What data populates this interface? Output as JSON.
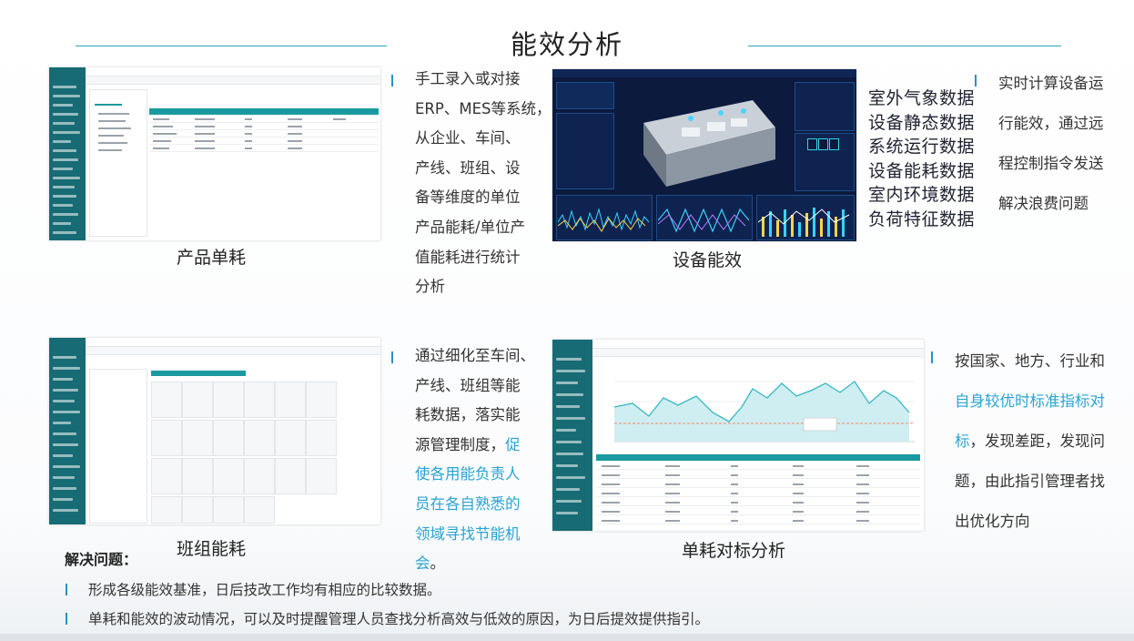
{
  "page_title": "能效分析",
  "sections": {
    "product": {
      "caption": "产品单耗",
      "text_lines": [
        "手工录入或对接",
        "ERP、MES等系统，",
        "从企业、车间、",
        "产线、班组、设",
        "备等维度的单位",
        "产品能耗/单位产",
        "值能耗进行统计",
        "分析"
      ]
    },
    "equipment": {
      "caption": "设备能效",
      "data_list": [
        "室外气象数据",
        "设备静态数据",
        "系统运行数据",
        "设备能耗数据",
        "室内环境数据",
        "负荷特征数据"
      ],
      "text_lines": [
        "实时计算设备运",
        "行能效，通过远",
        "程控制指令发送",
        "解决浪费问题"
      ]
    },
    "team": {
      "caption": "班组能耗",
      "text_lines": [
        "通过细化至车间、",
        "产线、班组等能",
        "耗数据，落实能"
      ],
      "text_mixed": {
        "normal": "源管理制度，",
        "highlight": "促"
      },
      "highlight_lines": [
        "使各用能负责人",
        "员在各自熟悉的",
        "领域寻找节能机"
      ],
      "text_end": {
        "highlight": "会",
        "normal": "。"
      }
    },
    "benchmark": {
      "caption": "单耗对标分析",
      "line1": "按国家、地方、行业和",
      "highlight_lines": [
        "自身较优时标准指标对",
        "标"
      ],
      "line3_rest": "，发现差距，发现问",
      "line4": "题，由此指引管理者找",
      "line5": "出优化方向"
    }
  },
  "solution": {
    "title": "解决问题：",
    "items": [
      "形成各级能效基准，日后技改工作均有相应的比较数据。",
      "单耗和能效的波动情况，可以及时提醒管理人员查找分析高效与低效的原因，为日后提效提供指引。"
    ]
  },
  "colors": {
    "accent": "#2aa3b5",
    "highlight": "#2aa3d3",
    "sidebar": "#176b74",
    "dashboard_bg": "#0b1a3d"
  }
}
